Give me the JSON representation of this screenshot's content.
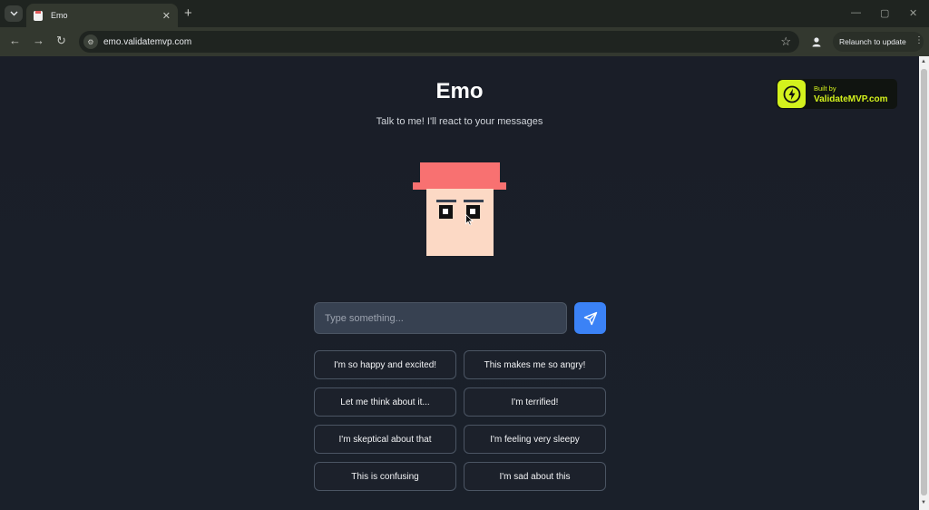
{
  "browser": {
    "tab_title": "Emo",
    "new_tab": "+",
    "url": "emo.validatemvp.com",
    "relaunch_label": "Relaunch to update"
  },
  "page": {
    "title": "Emo",
    "subtitle": "Talk to me! I'll react to your messages",
    "badge": {
      "small": "Built by",
      "big": "ValidateMVP.com",
      "accent": "#d4f21d"
    },
    "face": {
      "hat_color": "#f87171",
      "skin_color": "#fcd9c5"
    },
    "input": {
      "placeholder": "Type something...",
      "value": ""
    },
    "send_button": {
      "icon": "send-icon",
      "color": "#3b82f6"
    },
    "suggestions": [
      "I'm so happy and excited!",
      "This makes me so angry!",
      "Let me think about it...",
      "I'm terrified!",
      "I'm skeptical about that",
      "I'm feeling very sleepy",
      "This is confusing",
      "I'm sad about this"
    ]
  }
}
